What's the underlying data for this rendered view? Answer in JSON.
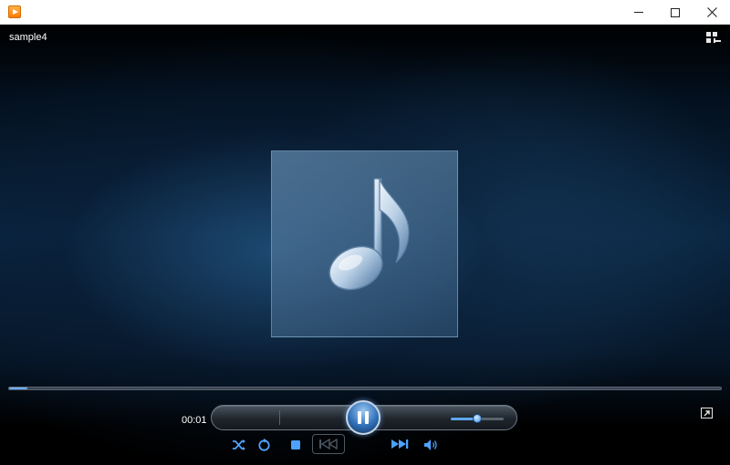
{
  "window": {
    "icon": "media-player-app-icon",
    "controls": [
      "minimize-icon",
      "maximize-icon",
      "close-icon"
    ]
  },
  "player": {
    "media_title": "sample4",
    "elapsed_time": "00:01",
    "seek_progress": 0.025,
    "volume_level": 0.5,
    "state": "playing",
    "album_art_icon": "music-note-icon",
    "top_right_icon": "switch-to-library-icon",
    "bottom_right_icon": "fullscreen-icon"
  },
  "controls": {
    "shuffle_icon": "shuffle-icon",
    "repeat_icon": "repeat-icon",
    "stop_icon": "stop-icon",
    "previous_icon": "previous-icon",
    "play_pause_icon": "pause-icon",
    "next_icon": "next-icon",
    "mute_icon": "speaker-icon"
  },
  "colors": {
    "accent": "#3c8de6",
    "title_bar": "#ffffff",
    "background": "#000000"
  }
}
